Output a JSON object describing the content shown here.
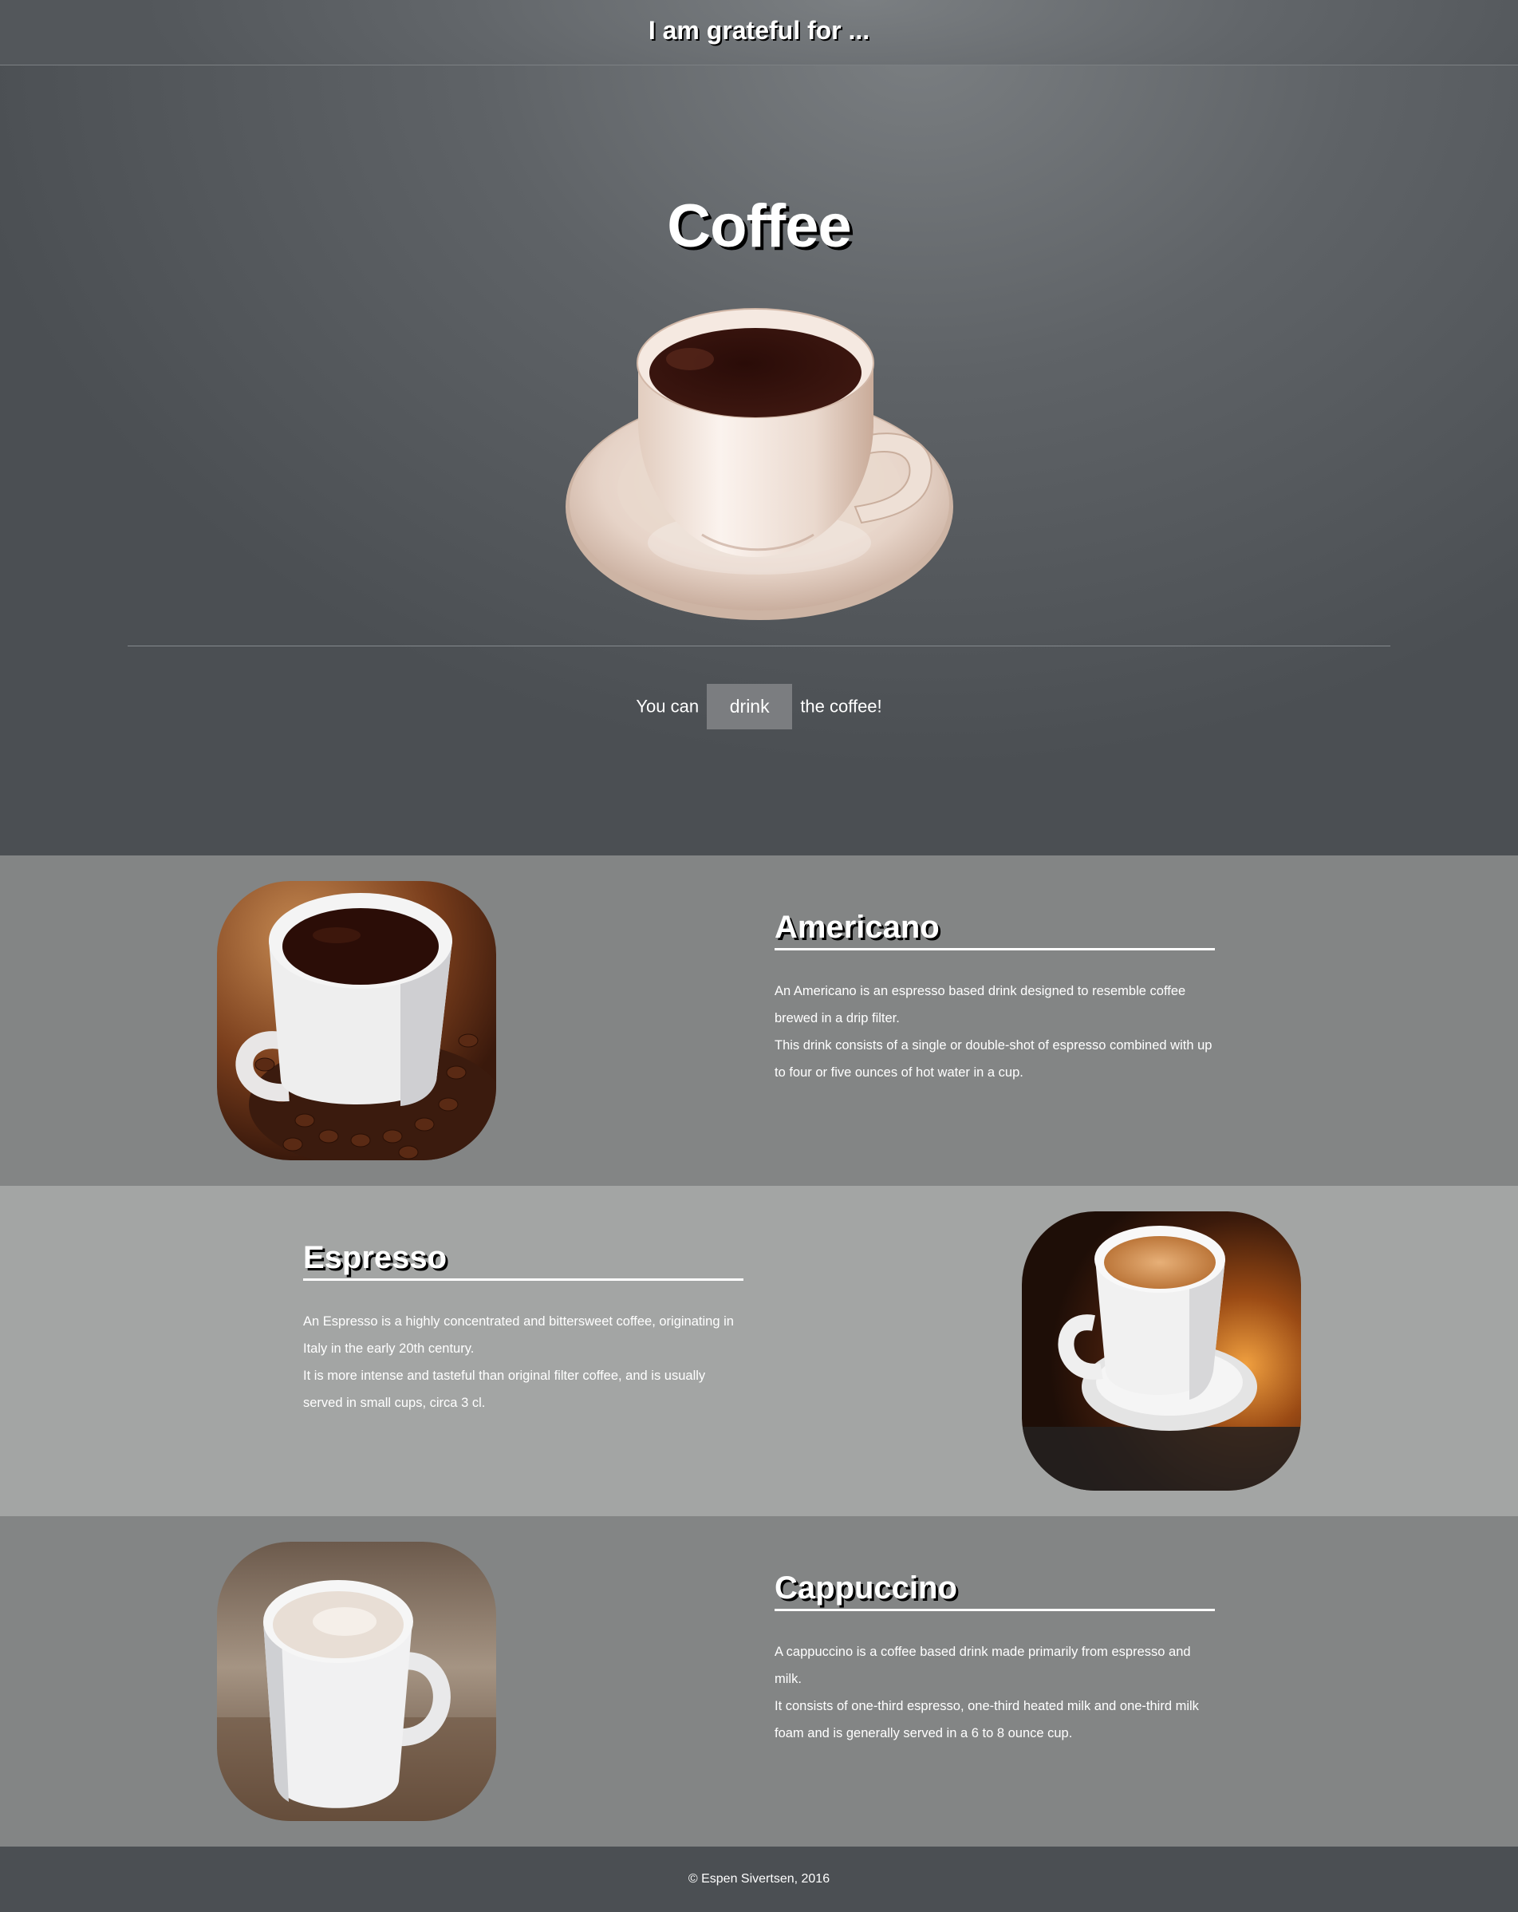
{
  "header": {
    "title": "I am grateful for ..."
  },
  "hero": {
    "title": "Coffee",
    "tagline_before": "You can",
    "button_label": "drink",
    "tagline_after": "the coffee!"
  },
  "sections": [
    {
      "title": "Americano",
      "lines": [
        "An Americano is an espresso based drink designed to resemble coffee brewed in a drip filter.",
        "This drink consists of a single or double-shot of espresso combined with up to four or five ounces of hot water in a cup."
      ]
    },
    {
      "title": "Espresso",
      "lines": [
        "An Espresso is a highly concentrated and bittersweet coffee, originating in Italy in the early 20th century.",
        "It is more intense and tasteful than original filter coffee, and is usually served in small cups, circa 3 cl."
      ]
    },
    {
      "title": "Cappuccino",
      "lines": [
        "A cappuccino is a coffee based drink made primarily from espresso and milk.",
        "It consists of one-third espresso, one-third heated milk and one-third milk foam and is generally served in a 6 to 8 ounce cup."
      ]
    }
  ],
  "footer": {
    "text": "© Espen Sivertsen, 2016"
  }
}
